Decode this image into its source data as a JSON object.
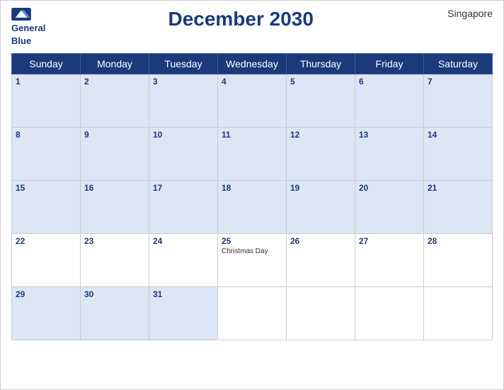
{
  "header": {
    "logo_line1": "General",
    "logo_line2": "Blue",
    "title": "December 2030",
    "country": "Singapore"
  },
  "weekdays": [
    "Sunday",
    "Monday",
    "Tuesday",
    "Wednesday",
    "Thursday",
    "Friday",
    "Saturday"
  ],
  "weeks": [
    [
      {
        "day": 1,
        "shade": "blue",
        "events": []
      },
      {
        "day": 2,
        "shade": "blue",
        "events": []
      },
      {
        "day": 3,
        "shade": "blue",
        "events": []
      },
      {
        "day": 4,
        "shade": "blue",
        "events": []
      },
      {
        "day": 5,
        "shade": "blue",
        "events": []
      },
      {
        "day": 6,
        "shade": "blue",
        "events": []
      },
      {
        "day": 7,
        "shade": "blue",
        "events": []
      }
    ],
    [
      {
        "day": 8,
        "shade": "blue",
        "events": []
      },
      {
        "day": 9,
        "shade": "blue",
        "events": []
      },
      {
        "day": 10,
        "shade": "blue",
        "events": []
      },
      {
        "day": 11,
        "shade": "blue",
        "events": []
      },
      {
        "day": 12,
        "shade": "blue",
        "events": []
      },
      {
        "day": 13,
        "shade": "blue",
        "events": []
      },
      {
        "day": 14,
        "shade": "blue",
        "events": []
      }
    ],
    [
      {
        "day": 15,
        "shade": "blue",
        "events": []
      },
      {
        "day": 16,
        "shade": "blue",
        "events": []
      },
      {
        "day": 17,
        "shade": "blue",
        "events": []
      },
      {
        "day": 18,
        "shade": "blue",
        "events": []
      },
      {
        "day": 19,
        "shade": "blue",
        "events": []
      },
      {
        "day": 20,
        "shade": "blue",
        "events": []
      },
      {
        "day": 21,
        "shade": "blue",
        "events": []
      }
    ],
    [
      {
        "day": 22,
        "shade": "white",
        "events": []
      },
      {
        "day": 23,
        "shade": "white",
        "events": []
      },
      {
        "day": 24,
        "shade": "white",
        "events": []
      },
      {
        "day": 25,
        "shade": "white",
        "events": [
          "Christmas Day"
        ]
      },
      {
        "day": 26,
        "shade": "white",
        "events": []
      },
      {
        "day": 27,
        "shade": "white",
        "events": []
      },
      {
        "day": 28,
        "shade": "white",
        "events": []
      }
    ],
    [
      {
        "day": 29,
        "shade": "blue",
        "events": []
      },
      {
        "day": 30,
        "shade": "blue",
        "events": []
      },
      {
        "day": 31,
        "shade": "blue",
        "events": []
      },
      {
        "day": null,
        "shade": "empty",
        "events": []
      },
      {
        "day": null,
        "shade": "empty",
        "events": []
      },
      {
        "day": null,
        "shade": "empty",
        "events": []
      },
      {
        "day": null,
        "shade": "empty",
        "events": []
      }
    ]
  ]
}
